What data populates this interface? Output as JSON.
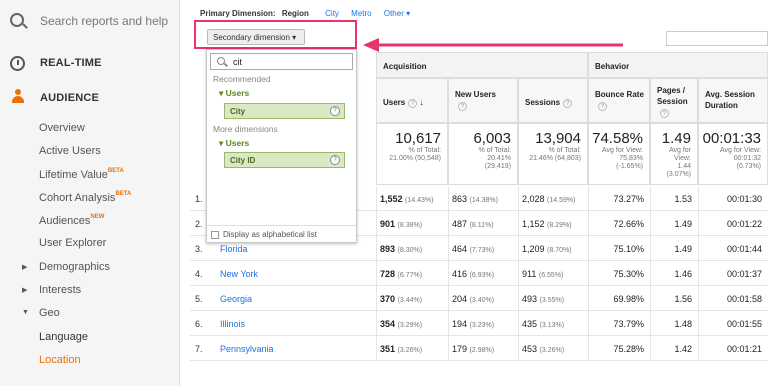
{
  "sidebar": {
    "search_placeholder": "Search reports and help",
    "realtime_label": "REAL-TIME",
    "audience_label": "AUDIENCE",
    "items": [
      {
        "label": "Overview",
        "badge": ""
      },
      {
        "label": "Active Users",
        "badge": ""
      },
      {
        "label": "Lifetime Value",
        "badge": "BETA"
      },
      {
        "label": "Cohort Analysis",
        "badge": "BETA"
      },
      {
        "label": "Audiences",
        "badge": "NEW"
      },
      {
        "label": "User Explorer",
        "badge": ""
      },
      {
        "label": "Demographics",
        "badge": ""
      },
      {
        "label": "Interests",
        "badge": ""
      },
      {
        "label": "Geo",
        "badge": ""
      },
      {
        "label": "Language",
        "badge": ""
      },
      {
        "label": "Location",
        "badge": ""
      }
    ]
  },
  "primary_dimension": {
    "label": "Primary Dimension:",
    "selected": "Region",
    "options": [
      "City",
      "Metro",
      "Other"
    ]
  },
  "secondary_dimension": {
    "label": "Secondary dimension"
  },
  "dropdown": {
    "search_value": "cit",
    "recommended_label": "Recommended",
    "group1": "Users",
    "chip1": "City",
    "more_label": "More dimensions",
    "group2": "Users",
    "chip2": "City ID",
    "alpha_label": "Display as alphabetical list"
  },
  "table": {
    "groups": {
      "acquisition": "Acquisition",
      "behavior": "Behavior"
    },
    "columns": {
      "users": "Users",
      "new_users": "New Users",
      "sessions": "Sessions",
      "bounce": "Bounce Rate",
      "pages": "Pages / Session",
      "duration": "Avg. Session Duration"
    },
    "totals": {
      "users": {
        "v": "10,617",
        "s1": "% of Total:",
        "s2": "21.00% (50,548)"
      },
      "new_users": {
        "v": "6,003",
        "s1": "% of Total:",
        "s2": "20.41%",
        "s3": "(29,419)"
      },
      "sessions": {
        "v": "13,904",
        "s1": "% of Total:",
        "s2": "21.46% (64,803)"
      },
      "bounce": {
        "v": "74.58%",
        "s1": "Avg for View:",
        "s2": "75.83%",
        "s3": "(-1.65%)"
      },
      "pages": {
        "v": "1.49",
        "s1": "Avg for",
        "s2": "View:",
        "s3": "1.44",
        "s4": "(3.07%)"
      },
      "duration": {
        "v": "00:01:33",
        "s1": "Avg for View:",
        "s2": "00:01:32",
        "s3": "(0.73%)"
      }
    },
    "rows": [
      {
        "n": "1.",
        "city": "",
        "users": "1,552",
        "users_pct": "(14.43%)",
        "new": "863",
        "new_pct": "(14.38%)",
        "sessions": "2,028",
        "sessions_pct": "(14.59%)",
        "bounce": "73.27%",
        "pages": "1.53",
        "dur": "00:01:30"
      },
      {
        "n": "2.",
        "city": "",
        "users": "901",
        "users_pct": "(8.38%)",
        "new": "487",
        "new_pct": "(8.11%)",
        "sessions": "1,152",
        "sessions_pct": "(8.29%)",
        "bounce": "72.66%",
        "pages": "1.49",
        "dur": "00:01:22"
      },
      {
        "n": "3.",
        "city": "Florida",
        "users": "893",
        "users_pct": "(8.30%)",
        "new": "464",
        "new_pct": "(7.73%)",
        "sessions": "1,209",
        "sessions_pct": "(8.70%)",
        "bounce": "75.10%",
        "pages": "1.49",
        "dur": "00:01:44"
      },
      {
        "n": "4.",
        "city": "New York",
        "users": "728",
        "users_pct": "(6.77%)",
        "new": "416",
        "new_pct": "(6.93%)",
        "sessions": "911",
        "sessions_pct": "(6.55%)",
        "bounce": "75.30%",
        "pages": "1.46",
        "dur": "00:01:37"
      },
      {
        "n": "5.",
        "city": "Georgia",
        "users": "370",
        "users_pct": "(3.44%)",
        "new": "204",
        "new_pct": "(3.40%)",
        "sessions": "493",
        "sessions_pct": "(3.55%)",
        "bounce": "69.98%",
        "pages": "1.56",
        "dur": "00:01:58"
      },
      {
        "n": "6.",
        "city": "Illinois",
        "users": "354",
        "users_pct": "(3.29%)",
        "new": "194",
        "new_pct": "(3.23%)",
        "sessions": "435",
        "sessions_pct": "(3.13%)",
        "bounce": "73.79%",
        "pages": "1.48",
        "dur": "00:01:55"
      },
      {
        "n": "7.",
        "city": "Pennsylvania",
        "users": "351",
        "users_pct": "(3.26%)",
        "new": "179",
        "new_pct": "(2.98%)",
        "sessions": "453",
        "sessions_pct": "(3.26%)",
        "bounce": "75.28%",
        "pages": "1.42",
        "dur": "00:01:21"
      }
    ]
  },
  "colors": {
    "accent": "#e8710a",
    "link": "#1a73e8",
    "highlight": "#e8336b"
  }
}
